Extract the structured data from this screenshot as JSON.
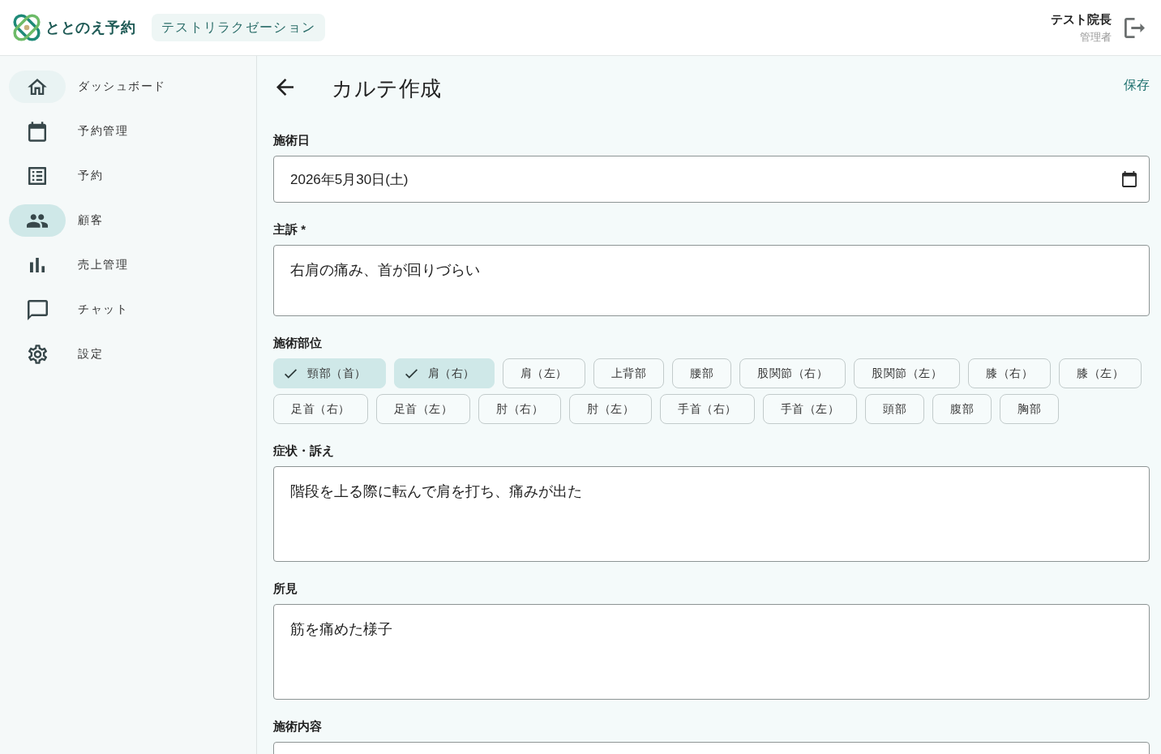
{
  "header": {
    "app_name": "ととのえ予約",
    "clinic": "テストリラクゼーション",
    "user": {
      "name": "テスト院長",
      "role": "管理者"
    }
  },
  "sidebar": {
    "items": [
      {
        "label": "ダッシュボード",
        "selected": false,
        "hovered": true
      },
      {
        "label": "予約管理",
        "selected": false,
        "hovered": false
      },
      {
        "label": "予約",
        "selected": false,
        "hovered": false
      },
      {
        "label": "顧客",
        "selected": true,
        "hovered": false
      },
      {
        "label": "売上管理",
        "selected": false,
        "hovered": false
      },
      {
        "label": "チャット",
        "selected": false,
        "hovered": false
      },
      {
        "label": "設定",
        "selected": false,
        "hovered": false
      }
    ]
  },
  "page": {
    "title": "カルテ作成",
    "save": "保存"
  },
  "form": {
    "fields": [
      {
        "kind": "date",
        "label": "施術日",
        "value": "2026年5月30日(土)"
      },
      {
        "kind": "short",
        "label": "主訴 *",
        "value": "右肩の痛み、首が回りづらい"
      },
      {
        "kind": "chips",
        "label": "施術部位",
        "chips": [
          {
            "label": "頸部（首）",
            "selected": true
          },
          {
            "label": "肩（右）",
            "selected": true
          },
          {
            "label": "肩（左）",
            "selected": false
          },
          {
            "label": "上背部",
            "selected": false
          },
          {
            "label": "腰部",
            "selected": false
          },
          {
            "label": "股関節（右）",
            "selected": false
          },
          {
            "label": "股関節（左）",
            "selected": false
          },
          {
            "label": "膝（右）",
            "selected": false
          },
          {
            "label": "膝（左）",
            "selected": false
          },
          {
            "label": "足首（右）",
            "selected": false
          },
          {
            "label": "足首（左）",
            "selected": false
          },
          {
            "label": "肘（右）",
            "selected": false
          },
          {
            "label": "肘（左）",
            "selected": false
          },
          {
            "label": "手首（右）",
            "selected": false
          },
          {
            "label": "手首（左）",
            "selected": false
          },
          {
            "label": "頭部",
            "selected": false
          },
          {
            "label": "腹部",
            "selected": false
          },
          {
            "label": "胸部",
            "selected": false
          }
        ]
      },
      {
        "kind": "long",
        "label": "症状・訴え",
        "value": "階段を上る際に転んで肩を打ち、痛みが出た"
      },
      {
        "kind": "long",
        "label": "所見",
        "value": "筋を痛めた様子"
      },
      {
        "kind": "long",
        "label": "施術内容"
      }
    ]
  }
}
